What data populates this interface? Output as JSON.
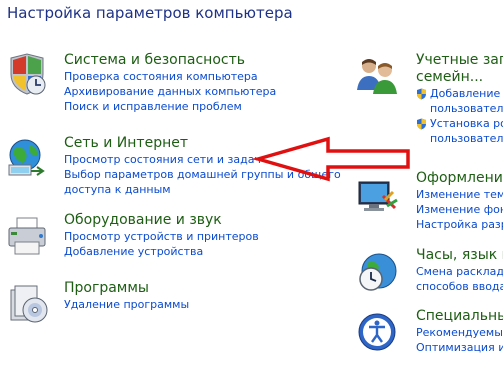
{
  "window": {
    "title": "Настройка параметров компьютера"
  },
  "categories": [
    {
      "title": "Система и безопасность",
      "icon": "security-shield-icon",
      "links": [
        "Проверка состояния компьютера",
        "Архивирование данных компьютера",
        "Поиск и исправление проблем"
      ]
    },
    {
      "title": "Сеть и Интернет",
      "icon": "network-globe-icon",
      "links": [
        "Просмотр состояния сети и задач",
        "Выбор параметров домашней группы и общего",
        "доступа к данным"
      ]
    },
    {
      "title": "Оборудование и звук",
      "icon": "printer-icon",
      "links": [
        "Просмотр устройств и принтеров",
        "Добавление устройства"
      ]
    },
    {
      "title": "Программы",
      "icon": "programs-disk-icon",
      "links": [
        "Удаление программы"
      ]
    },
    {
      "title_lines": [
        "Учетные запи",
        "семейн..."
      ],
      "icon": "user-accounts-icon",
      "links": [
        "Добавление и",
        "пользовател",
        "Установка ро",
        "пользовател"
      ]
    },
    {
      "title": "Оформление",
      "icon": "appearance-monitor-icon",
      "links": [
        "Изменение тем",
        "Изменение фон",
        "Настройка разр"
      ]
    },
    {
      "title": "Часы, язык и",
      "icon": "clock-globe-icon",
      "links": [
        "Смена расклад",
        "способов ввода"
      ]
    },
    {
      "title": "Специальны",
      "icon": "accessibility-icon",
      "links": [
        "Рекомендуемые",
        "Оптимизация из"
      ]
    }
  ],
  "colors": {
    "title": "#1e3287",
    "category": "#1e5e14",
    "link": "#0b4bcf",
    "arrow": "#e11010"
  }
}
